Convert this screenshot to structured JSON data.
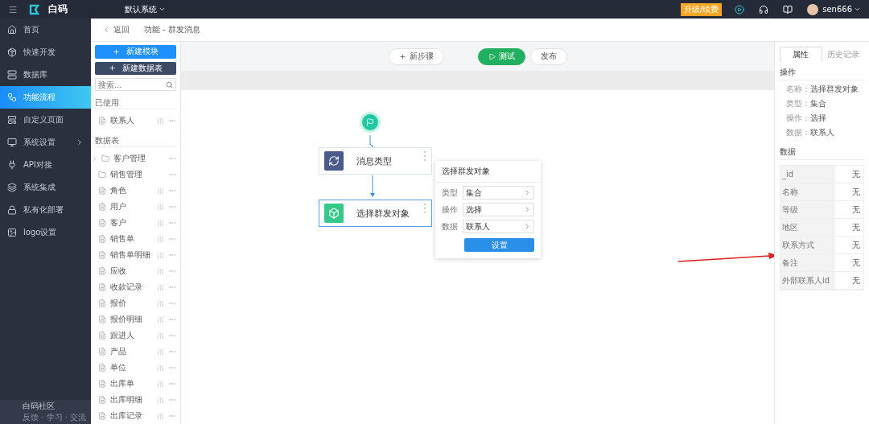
{
  "topbar": {
    "logo": "白码",
    "system": "默认系统",
    "upgrade": "升级/续费",
    "user": "sen666"
  },
  "sidebar": {
    "items": [
      {
        "label": "首页",
        "selected": false,
        "submenu": false
      },
      {
        "label": "快速开发",
        "selected": false,
        "submenu": false
      },
      {
        "label": "数据库",
        "selected": false,
        "submenu": false
      },
      {
        "label": "功能流程",
        "selected": true,
        "submenu": false
      },
      {
        "label": "自定义页面",
        "selected": false,
        "submenu": false
      },
      {
        "label": "系统设置",
        "selected": false,
        "submenu": true
      },
      {
        "label": "API对接",
        "selected": false,
        "submenu": false
      },
      {
        "label": "系统集成",
        "selected": false,
        "submenu": false
      },
      {
        "label": "私有化部署",
        "selected": false,
        "submenu": false
      },
      {
        "label": "logo设置",
        "selected": false,
        "submenu": false
      }
    ],
    "footer": {
      "title": "白码社区",
      "subtitle": "反馈 · 学习 · 交流"
    }
  },
  "breadcrumb": {
    "back": "返回",
    "title": "功能 - 群发消息"
  },
  "left_panel": {
    "buttons": [
      {
        "label": "新建模块",
        "kind": "primary"
      },
      {
        "label": "新建数据表",
        "kind": "dark"
      }
    ],
    "search": {
      "placeholder": "搜索..."
    },
    "sections": [
      {
        "title": "已使用",
        "items": [
          {
            "label": "联系人",
            "kind": "table"
          }
        ]
      },
      {
        "title": "数据表",
        "items": [
          {
            "label": "客户管理",
            "kind": "group"
          },
          {
            "label": "销售管理",
            "kind": "folder"
          },
          {
            "label": "角色",
            "kind": "table"
          },
          {
            "label": "用户",
            "kind": "table"
          },
          {
            "label": "客户",
            "kind": "table"
          },
          {
            "label": "销售单",
            "kind": "table"
          },
          {
            "label": "销售单明细",
            "kind": "table"
          },
          {
            "label": "应收",
            "kind": "table"
          },
          {
            "label": "收款记录",
            "kind": "table"
          },
          {
            "label": "报价",
            "kind": "table"
          },
          {
            "label": "报价明细",
            "kind": "table"
          },
          {
            "label": "跟进人",
            "kind": "table"
          },
          {
            "label": "产品",
            "kind": "table"
          },
          {
            "label": "单位",
            "kind": "table"
          },
          {
            "label": "出库单",
            "kind": "table"
          },
          {
            "label": "出库明细",
            "kind": "table"
          },
          {
            "label": "出库记录",
            "kind": "table"
          }
        ]
      }
    ]
  },
  "toolbar": {
    "add_step": "新步骤",
    "test": "测试",
    "publish": "发布"
  },
  "flow": {
    "nodes": [
      {
        "title": "消息类型",
        "kind": "message",
        "selected": false
      },
      {
        "title": "选择群发对象",
        "kind": "select",
        "selected": true
      }
    ]
  },
  "popup": {
    "title": "选择群发对象",
    "fields": [
      {
        "label": "类型",
        "value": "集合"
      },
      {
        "label": "操作",
        "value": "选择"
      },
      {
        "label": "数据",
        "value": "联系人"
      }
    ],
    "button": "设置"
  },
  "properties": {
    "tabs": [
      {
        "label": "属性",
        "selected": true
      },
      {
        "label": "历史记录",
        "selected": false
      }
    ],
    "operation": {
      "title": "操作",
      "rows": [
        {
          "label": "名称：",
          "value": "选择群发对象"
        },
        {
          "label": "类型：",
          "value": "集合"
        },
        {
          "label": "操作：",
          "value": "选择"
        },
        {
          "label": "数据：",
          "value": "联系人"
        }
      ]
    },
    "data": {
      "title": "数据",
      "rows": [
        {
          "label": "_id",
          "value": "无"
        },
        {
          "label": "名称",
          "value": "无"
        },
        {
          "label": "等级",
          "value": "无"
        },
        {
          "label": "地区",
          "value": "无"
        },
        {
          "label": "联系方式",
          "value": "无"
        },
        {
          "label": "备注",
          "value": "无"
        },
        {
          "label": "外部联系人id",
          "value": "无"
        }
      ]
    }
  }
}
